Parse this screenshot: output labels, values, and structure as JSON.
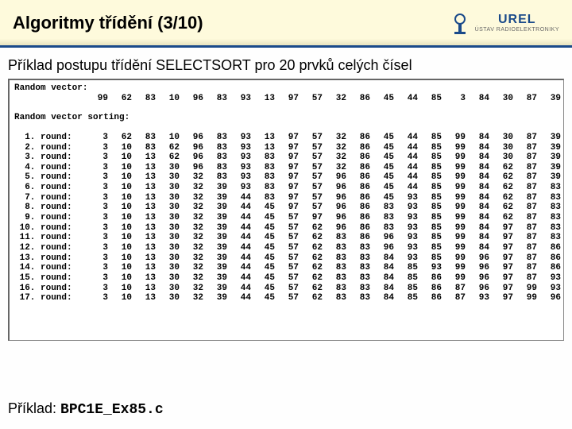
{
  "header": {
    "title": "Algoritmy třídění (3/10)",
    "logo_text": "UREL",
    "logo_sub": "ÚSTAV RADIOELEKTRONIKY"
  },
  "subtitle": "Příklad postupu třídění SELECTSORT pro 20 prvků celých čísel",
  "console": {
    "random_label": "Random vector:",
    "random_values": [
      99,
      62,
      83,
      10,
      96,
      83,
      93,
      13,
      97,
      57,
      32,
      86,
      45,
      44,
      85,
      3,
      84,
      30,
      87,
      39
    ],
    "sorting_label": "Random vector sorting:",
    "rounds": [
      {
        "n": 1,
        "v": [
          3,
          62,
          83,
          10,
          96,
          83,
          93,
          13,
          97,
          57,
          32,
          86,
          45,
          44,
          85,
          99,
          84,
          30,
          87,
          39
        ]
      },
      {
        "n": 2,
        "v": [
          3,
          10,
          83,
          62,
          96,
          83,
          93,
          13,
          97,
          57,
          32,
          86,
          45,
          44,
          85,
          99,
          84,
          30,
          87,
          39
        ]
      },
      {
        "n": 3,
        "v": [
          3,
          10,
          13,
          62,
          96,
          83,
          93,
          83,
          97,
          57,
          32,
          86,
          45,
          44,
          85,
          99,
          84,
          30,
          87,
          39
        ]
      },
      {
        "n": 4,
        "v": [
          3,
          10,
          13,
          30,
          96,
          83,
          93,
          83,
          97,
          57,
          32,
          86,
          45,
          44,
          85,
          99,
          84,
          62,
          87,
          39
        ]
      },
      {
        "n": 5,
        "v": [
          3,
          10,
          13,
          30,
          32,
          83,
          93,
          83,
          97,
          57,
          96,
          86,
          45,
          44,
          85,
          99,
          84,
          62,
          87,
          39
        ]
      },
      {
        "n": 6,
        "v": [
          3,
          10,
          13,
          30,
          32,
          39,
          93,
          83,
          97,
          57,
          96,
          86,
          45,
          44,
          85,
          99,
          84,
          62,
          87,
          83
        ]
      },
      {
        "n": 7,
        "v": [
          3,
          10,
          13,
          30,
          32,
          39,
          44,
          83,
          97,
          57,
          96,
          86,
          45,
          93,
          85,
          99,
          84,
          62,
          87,
          83
        ]
      },
      {
        "n": 8,
        "v": [
          3,
          10,
          13,
          30,
          32,
          39,
          44,
          45,
          97,
          57,
          96,
          86,
          83,
          93,
          85,
          99,
          84,
          62,
          87,
          83
        ]
      },
      {
        "n": 9,
        "v": [
          3,
          10,
          13,
          30,
          32,
          39,
          44,
          45,
          57,
          97,
          96,
          86,
          83,
          93,
          85,
          99,
          84,
          62,
          87,
          83
        ]
      },
      {
        "n": 10,
        "v": [
          3,
          10,
          13,
          30,
          32,
          39,
          44,
          45,
          57,
          62,
          96,
          86,
          83,
          93,
          85,
          99,
          84,
          97,
          87,
          83
        ]
      },
      {
        "n": 11,
        "v": [
          3,
          10,
          13,
          30,
          32,
          39,
          44,
          45,
          57,
          62,
          83,
          86,
          96,
          93,
          85,
          99,
          84,
          97,
          87,
          83
        ]
      },
      {
        "n": 12,
        "v": [
          3,
          10,
          13,
          30,
          32,
          39,
          44,
          45,
          57,
          62,
          83,
          83,
          96,
          93,
          85,
          99,
          84,
          97,
          87,
          86
        ]
      },
      {
        "n": 13,
        "v": [
          3,
          10,
          13,
          30,
          32,
          39,
          44,
          45,
          57,
          62,
          83,
          83,
          84,
          93,
          85,
          99,
          96,
          97,
          87,
          86
        ]
      },
      {
        "n": 14,
        "v": [
          3,
          10,
          13,
          30,
          32,
          39,
          44,
          45,
          57,
          62,
          83,
          83,
          84,
          85,
          93,
          99,
          96,
          97,
          87,
          86
        ]
      },
      {
        "n": 15,
        "v": [
          3,
          10,
          13,
          30,
          32,
          39,
          44,
          45,
          57,
          62,
          83,
          83,
          84,
          85,
          86,
          99,
          96,
          97,
          87,
          93
        ]
      },
      {
        "n": 16,
        "v": [
          3,
          10,
          13,
          30,
          32,
          39,
          44,
          45,
          57,
          62,
          83,
          83,
          84,
          85,
          86,
          87,
          96,
          97,
          99,
          93
        ]
      },
      {
        "n": 17,
        "v": [
          3,
          10,
          13,
          30,
          32,
          39,
          44,
          45,
          57,
          62,
          83,
          83,
          84,
          85,
          86,
          87,
          93,
          97,
          99,
          96
        ]
      }
    ]
  },
  "footer": {
    "prefix": "Příklad: ",
    "filename": "BPC1E_Ex85.c"
  }
}
